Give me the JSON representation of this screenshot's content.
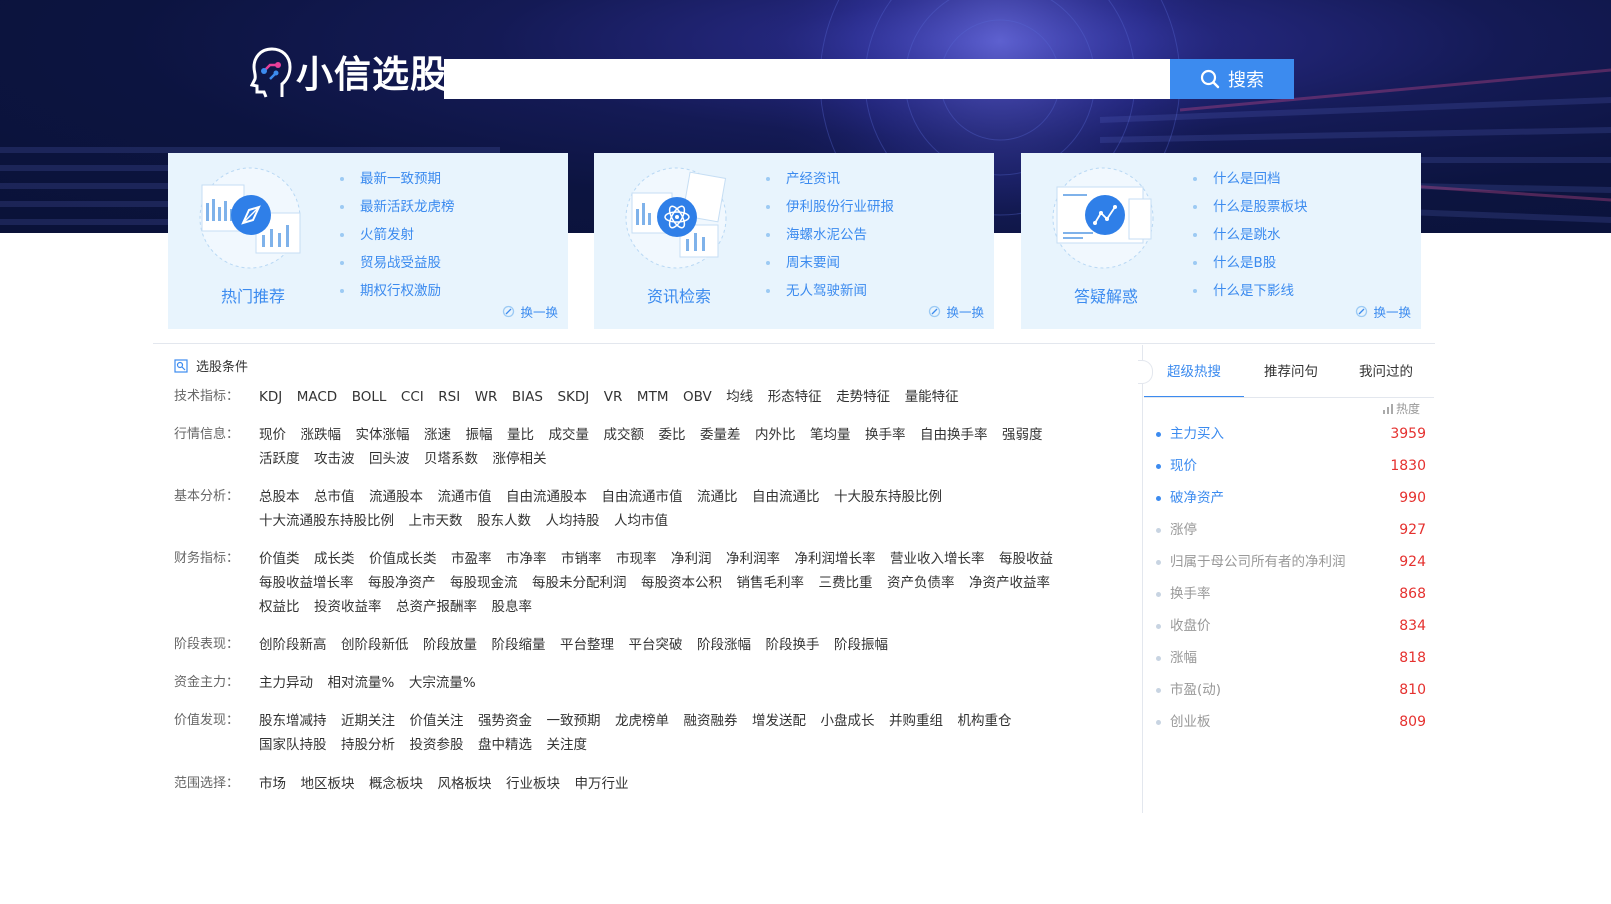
{
  "header": {
    "logo_text": "小信选股",
    "search_placeholder": "",
    "search_button": "搜索"
  },
  "cards": [
    {
      "title": "热门推荐",
      "items": [
        "最新一致预期",
        "最新活跃龙虎榜",
        "火箭发射",
        "贸易战受益股",
        "期权行权激励"
      ],
      "refresh": "换一换",
      "icon": "chart-compass-icon"
    },
    {
      "title": "资讯检索",
      "items": [
        "产经资讯",
        "伊利股份行业研报",
        "海螺水泥公告",
        "周末要闻",
        "无人驾驶新闻"
      ],
      "refresh": "换一换",
      "icon": "atom-icon"
    },
    {
      "title": "答疑解惑",
      "items": [
        "什么是回档",
        "什么是股票板块",
        "什么是跳水",
        "什么是B股",
        "什么是下影线"
      ],
      "refresh": "换一换",
      "icon": "trend-line-icon"
    }
  ],
  "conditions": {
    "title": "选股条件",
    "rows": [
      {
        "label": "技术指标：",
        "items": [
          "KDJ",
          "MACD",
          "BOLL",
          "CCI",
          "RSI",
          "WR",
          "BIAS",
          "SKDJ",
          "VR",
          "MTM",
          "OBV",
          "均线",
          "形态特征",
          "走势特征",
          "量能特征"
        ]
      },
      {
        "label": "行情信息：",
        "items": [
          "现价",
          "涨跌幅",
          "实体涨幅",
          "涨速",
          "振幅",
          "量比",
          "成交量",
          "成交额",
          "委比",
          "委量差",
          "内外比",
          "笔均量",
          "换手率",
          "自由换手率",
          "强弱度",
          "活跃度",
          "攻击波",
          "回头波",
          "贝塔系数",
          "涨停相关"
        ]
      },
      {
        "label": "基本分析：",
        "items": [
          "总股本",
          "总市值",
          "流通股本",
          "流通市值",
          "自由流通股本",
          "自由流通市值",
          "流通比",
          "自由流通比",
          "十大股东持股比例",
          "十大流通股东持股比例",
          "上市天数",
          "股东人数",
          "人均持股",
          "人均市值"
        ]
      },
      {
        "label": "财务指标：",
        "items": [
          "价值类",
          "成长类",
          "价值成长类",
          "市盈率",
          "市净率",
          "市销率",
          "市现率",
          "净利润",
          "净利润率",
          "净利润增长率",
          "营业收入增长率",
          "每股收益",
          "每股收益增长率",
          "每股净资产",
          "每股现金流",
          "每股未分配利润",
          "每股资本公积",
          "销售毛利率",
          "三费比重",
          "资产负债率",
          "净资产收益率",
          "权益比",
          "投资收益率",
          "总资产报酬率",
          "股息率"
        ]
      },
      {
        "label": "阶段表现：",
        "items": [
          "创阶段新高",
          "创阶段新低",
          "阶段放量",
          "阶段缩量",
          "平台整理",
          "平台突破",
          "阶段涨幅",
          "阶段换手",
          "阶段振幅"
        ]
      },
      {
        "label": "资金主力：",
        "items": [
          "主力异动",
          "相对流量%",
          "大宗流量%"
        ]
      },
      {
        "label": "价值发现：",
        "items": [
          "股东增减持",
          "近期关注",
          "价值关注",
          "强势资金",
          "一致预期",
          "龙虎榜单",
          "融资融券",
          "增发送配",
          "小盘成长",
          "并购重组",
          "机构重仓",
          "国家队持股",
          "持股分析",
          "投资参股",
          "盘中精选",
          "关注度"
        ]
      },
      {
        "label": "范围选择：",
        "items": [
          "市场",
          "地区板块",
          "概念板块",
          "风格板块",
          "行业板块",
          "申万行业"
        ]
      }
    ]
  },
  "sidebar": {
    "tabs": [
      "超级热搜",
      "推荐问句",
      "我问过的"
    ],
    "heat_label": "热度",
    "hot": [
      {
        "name": "主力买入",
        "count": "3959"
      },
      {
        "name": "现价",
        "count": "1830"
      },
      {
        "name": "破净资产",
        "count": "990"
      },
      {
        "name": "涨停",
        "count": "927"
      },
      {
        "name": "归属于母公司所有者的净利润",
        "count": "924"
      },
      {
        "name": "换手率",
        "count": "868"
      },
      {
        "name": "收盘价",
        "count": "834"
      },
      {
        "name": "涨幅",
        "count": "818"
      },
      {
        "name": "市盈(动)",
        "count": "810"
      },
      {
        "name": "创业板",
        "count": "809"
      }
    ]
  },
  "colors": {
    "accent": "#3c8bef",
    "hot_number": "#e5312f",
    "card_bg": "#e8f4fd",
    "hero_bg": "#0c1440"
  }
}
